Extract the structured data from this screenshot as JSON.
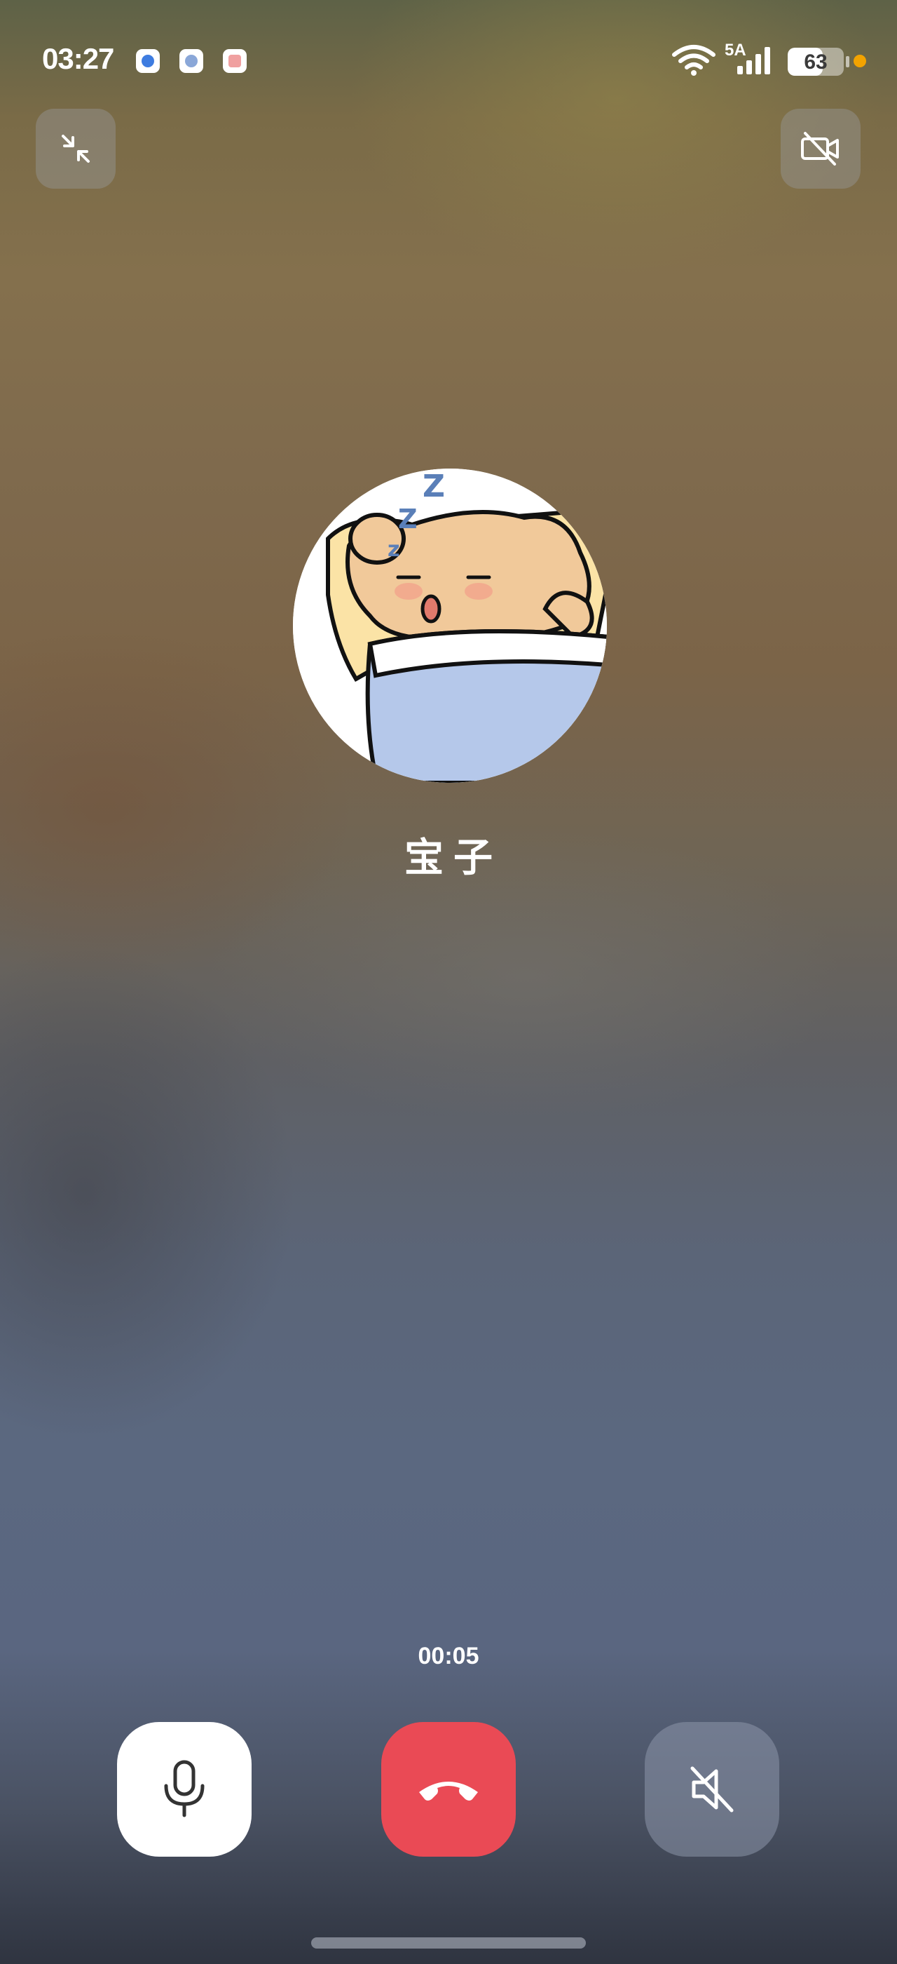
{
  "status_bar": {
    "time": "03:27",
    "network_label": "5A",
    "battery_level": 63,
    "battery_text": "63",
    "notification_icons": [
      "voice-assistant-icon",
      "browser-icon",
      "office-app-icon"
    ],
    "charging_dot_color": "#f3a300"
  },
  "top_controls": {
    "minimize_icon": "minimize-icon",
    "camera_off_icon": "camera-off-icon"
  },
  "contact": {
    "name": "宝子",
    "avatar": "sleeping-cartoon-avatar"
  },
  "call": {
    "duration": "00:05"
  },
  "controls": {
    "mic_icon": "microphone-icon",
    "hangup_icon": "hang-up-icon",
    "speaker_icon": "speaker-muted-icon",
    "hangup_color": "#ea4a55"
  }
}
